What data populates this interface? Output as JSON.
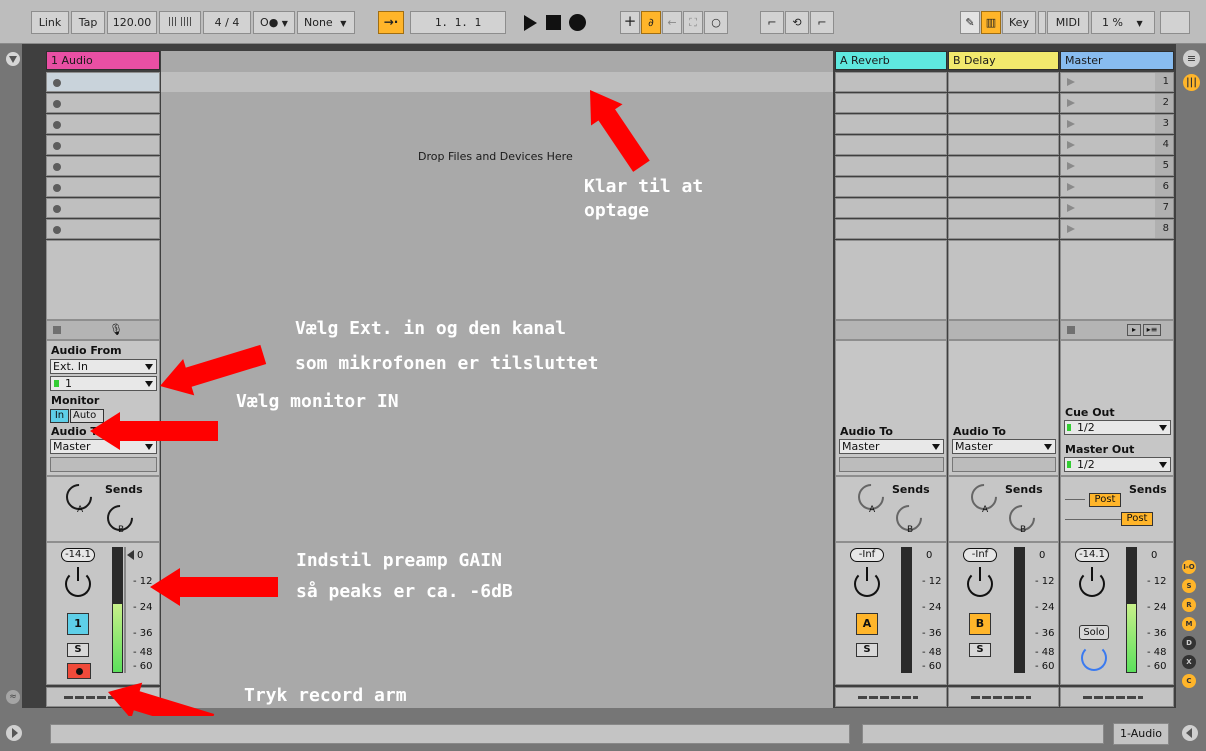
{
  "transport": {
    "link": "Link",
    "tap": "Tap",
    "tempo": "120.00",
    "meter_bars": "|||  ||||",
    "signature": "4 / 4",
    "metronome": "O●",
    "quantize": "None",
    "position": "1.  1.  1",
    "key": "Key",
    "midi": "MIDI",
    "cpu": "1 %"
  },
  "tracks": {
    "audio": {
      "name": "1 Audio",
      "color": "#e94fa4"
    },
    "reverb": {
      "name": "A Reverb",
      "color": "#5fe8df"
    },
    "delay": {
      "name": "B Delay",
      "color": "#f2e96d"
    },
    "master": {
      "name": "Master",
      "color": "#88bcf0"
    }
  },
  "drop_text": "Drop Files and Devices Here",
  "scenes": [
    "1",
    "2",
    "3",
    "4",
    "5",
    "6",
    "7",
    "8"
  ],
  "io": {
    "audio_from_label": "Audio From",
    "audio_from_value": "Ext. In",
    "channel_value": "1",
    "monitor_label": "Monitor",
    "monitor_in": "In",
    "monitor_auto": "Auto",
    "audio_to_label": "Audio To",
    "audio_to_value": "Master",
    "return_a_to_label": "Audio To",
    "return_a_to_value": "Master",
    "return_b_to_label": "Audio To",
    "return_b_to_value": "Master",
    "cue_out_label": "Cue Out",
    "cue_out_value": "1/2",
    "master_out_label": "Master Out",
    "master_out_value": "1/2"
  },
  "sends": {
    "label": "Sends",
    "a": "A",
    "b": "B",
    "post": "Post"
  },
  "mixer": {
    "audio_peak": "-14.1",
    "reverb_peak": "-Inf",
    "delay_peak": "-Inf",
    "master_peak": "-14.1",
    "scale": [
      "0",
      "12",
      "24",
      "36",
      "48",
      "60"
    ],
    "audio_number": "1",
    "reverb_letter": "A",
    "delay_letter": "B",
    "solo": "S",
    "master_solo": "Solo",
    "audio_meter_level": 0.55,
    "master_meter_level": 0.55
  },
  "side_buttons": [
    "I-O",
    "S",
    "R",
    "M",
    "D",
    "X",
    "C"
  ],
  "bottom": {
    "track_label": "1-Audio"
  },
  "annotations": {
    "arm_ready": "Klar til at\noptage",
    "select_input_1": "Vælg Ext. in og den kanal",
    "select_input_2": "som mikrofonen er tilsluttet",
    "monitor": "Vælg monitor IN",
    "gain_1": "Indstil preamp GAIN",
    "gain_2": "så peaks er ca. -6dB",
    "record": "Tryk record arm"
  },
  "colors": {
    "accent_orange": "#ffb52a",
    "monitor_blue": "#5ecfe8",
    "arm_red": "#f04a3a",
    "meter_green": "#5ce05c",
    "arrow_red": "#ff0000"
  }
}
